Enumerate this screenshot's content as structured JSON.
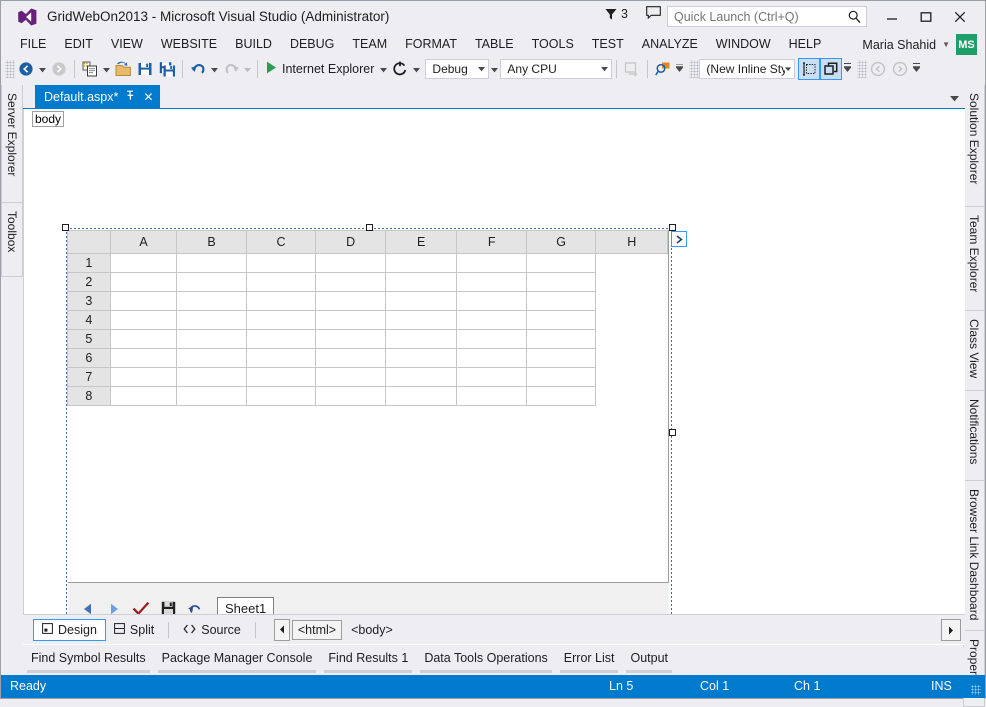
{
  "window": {
    "title": "GridWebOn2013 - Microsoft Visual Studio (Administrator)",
    "logo": "visual-studio-logo",
    "notification_count": "3",
    "minimize": "—",
    "maximize": "❐",
    "close": "✕"
  },
  "quick_launch": {
    "placeholder": "Quick Launch (Ctrl+Q)",
    "value": ""
  },
  "menu": {
    "items": [
      {
        "label": "FILE"
      },
      {
        "label": "EDIT"
      },
      {
        "label": "VIEW"
      },
      {
        "label": "WEBSITE"
      },
      {
        "label": "BUILD"
      },
      {
        "label": "DEBUG"
      },
      {
        "label": "TEAM"
      },
      {
        "label": "FORMAT"
      },
      {
        "label": "TABLE"
      },
      {
        "label": "TOOLS"
      },
      {
        "label": "TEST"
      },
      {
        "label": "ANALYZE"
      },
      {
        "label": "WINDOW"
      },
      {
        "label": "HELP"
      }
    ],
    "account_name": "Maria Shahid",
    "account_initials": "MS"
  },
  "toolbar": {
    "navigate_back": "navigate-back-icon",
    "navigate_forward": "navigate-forward-icon",
    "new_item": "new-item-icon",
    "open_file": "open-file-icon",
    "save": "save-icon",
    "save_all": "save-all-icon",
    "undo": "undo-icon",
    "redo": "redo-icon",
    "start_debug_label": "Internet Explorer",
    "refresh": "refresh-icon",
    "configuration": "Debug",
    "platform": "Any CPU",
    "style_target": "(New Inline Style",
    "style_application_label": "style-application-icon",
    "outline_label": "outline-icon"
  },
  "document_tab": {
    "name": "Default.aspx*",
    "pin": "pin-icon",
    "close": "✕"
  },
  "breadcrumb": {
    "tag": "body"
  },
  "designer": {
    "view_tabs": [
      {
        "label": "Design",
        "active": true
      },
      {
        "label": "Split",
        "active": false
      },
      {
        "label": "Source",
        "active": false
      }
    ],
    "tag_navigator": [
      {
        "label": "<html>",
        "selected": true
      },
      {
        "label": "<body>",
        "selected": false
      }
    ]
  },
  "grid_control": {
    "corner_label": "",
    "columns": [
      "A",
      "B",
      "C",
      "D",
      "E",
      "F",
      "G",
      "H"
    ],
    "rows": [
      "1",
      "2",
      "3",
      "4",
      "5",
      "6",
      "7",
      "8"
    ],
    "cells": [
      [
        "",
        "",
        "",
        "",
        "",
        "",
        "",
        ""
      ],
      [
        "",
        "",
        "",
        "",
        "",
        "",
        "",
        ""
      ],
      [
        "",
        "",
        "",
        "",
        "",
        "",
        "",
        ""
      ],
      [
        "",
        "",
        "",
        "",
        "",
        "",
        "",
        ""
      ],
      [
        "",
        "",
        "",
        "",
        "",
        "",
        "",
        ""
      ],
      [
        "",
        "",
        "",
        "",
        "",
        "",
        "",
        ""
      ],
      [
        "",
        "",
        "",
        "",
        "",
        "",
        "",
        ""
      ],
      [
        "",
        "",
        "",
        "",
        "",
        "",
        "",
        ""
      ]
    ],
    "sheet_toolbar": {
      "prev": "prev-sheet-icon",
      "next": "next-sheet-icon",
      "submit": "submit-check-icon",
      "save": "save-icon",
      "undo": "undo-icon"
    },
    "sheet_tab": "Sheet1",
    "expander": "expand-icon"
  },
  "dock_left": {
    "items": [
      {
        "label": "Server Explorer"
      },
      {
        "label": "Toolbox"
      }
    ]
  },
  "dock_right": {
    "items": [
      {
        "label": "Solution Explorer"
      },
      {
        "label": "Team Explorer"
      },
      {
        "label": "Class View"
      },
      {
        "label": "Notifications"
      },
      {
        "label": "Browser Link Dashboard"
      },
      {
        "label": "Properties"
      }
    ]
  },
  "bottom_tabs": {
    "items": [
      {
        "label": "Find Symbol Results"
      },
      {
        "label": "Package Manager Console"
      },
      {
        "label": "Find Results 1"
      },
      {
        "label": "Data Tools Operations"
      },
      {
        "label": "Error List"
      },
      {
        "label": "Output"
      }
    ]
  },
  "status_bar": {
    "state": "Ready",
    "line": "Ln 5",
    "column": "Col 1",
    "character": "Ch 1",
    "insert_mode": "INS"
  },
  "colors": {
    "accent": "#007acc",
    "chrome": "#eeeef2",
    "avatar": "#1e9e68",
    "selection": "#3399ff"
  }
}
